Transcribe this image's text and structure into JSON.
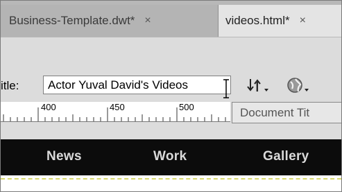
{
  "tabs": [
    {
      "label": "Business-Template.dwt*",
      "close": "×",
      "active": false
    },
    {
      "label": "videos.html*",
      "close": "×",
      "active": true
    }
  ],
  "toolbar": {
    "title_label": "itle:",
    "title_value": "Actor Yuval David's Videos",
    "sort_icon": "file-management-icon",
    "globe_icon": "preview-globe-icon"
  },
  "ruler": {
    "labels": [
      "400",
      "450",
      "500"
    ]
  },
  "tooltip": {
    "text": "Document Tit"
  },
  "site_nav": {
    "items": [
      "News",
      "Work",
      "Gallery"
    ]
  },
  "colors": {
    "nav_background": "#0c0c0c",
    "nav_text": "#dadada",
    "tab_active": "#e4e4e4",
    "tab_inactive": "#b4b4b4"
  }
}
